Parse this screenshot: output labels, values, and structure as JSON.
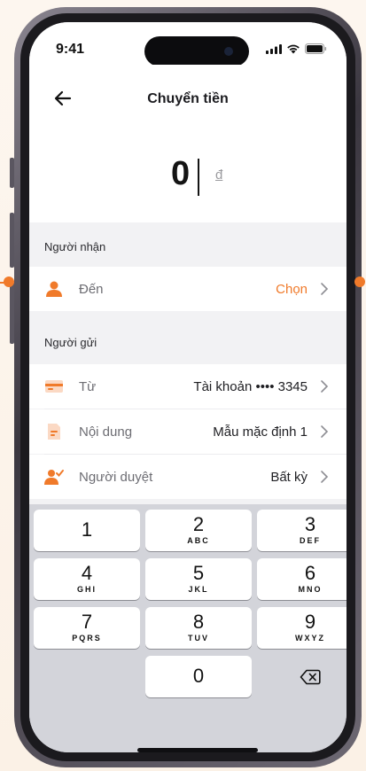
{
  "colors": {
    "accent": "#f07a2a",
    "text": "#1e1e22",
    "muted": "#6d6d73",
    "keypad_bg": "#d3d4da"
  },
  "status_bar": {
    "time": "9:41",
    "icons": [
      "signal-icon",
      "wifi-icon",
      "battery-icon"
    ]
  },
  "header": {
    "title": "Chuyển tiền",
    "back_icon": "arrow-left-icon"
  },
  "amount": {
    "value": "0",
    "currency": "đ"
  },
  "recipient_section": {
    "label": "Người nhận",
    "to": {
      "label": "Đến",
      "value": "Chọn",
      "icon": "person-icon"
    }
  },
  "sender_section": {
    "label": "Người gửi",
    "rows": [
      {
        "label": "Từ",
        "value": "Tài khoản •••• 3345",
        "icon": "card-icon"
      },
      {
        "label": "Nội dung",
        "value": "Mẫu mặc định 1",
        "icon": "document-icon"
      },
      {
        "label": "Người duyệt",
        "value": "Bất kỳ",
        "icon": "approver-icon"
      }
    ]
  },
  "keypad": {
    "keys": [
      {
        "digit": "1",
        "letters": ""
      },
      {
        "digit": "2",
        "letters": "ABC"
      },
      {
        "digit": "3",
        "letters": "DEF"
      },
      {
        "digit": "4",
        "letters": "GHI"
      },
      {
        "digit": "5",
        "letters": "JKL"
      },
      {
        "digit": "6",
        "letters": "MNO"
      },
      {
        "digit": "7",
        "letters": "PQRS"
      },
      {
        "digit": "8",
        "letters": "TUV"
      },
      {
        "digit": "9",
        "letters": "WXYZ"
      },
      {
        "digit": "0",
        "letters": ""
      }
    ],
    "delete_icon": "backspace-icon"
  }
}
